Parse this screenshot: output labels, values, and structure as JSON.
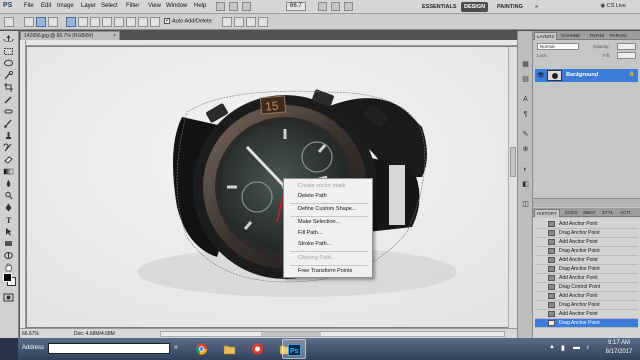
{
  "app": {
    "logo": "PS",
    "menus": [
      "File",
      "Edit",
      "Image",
      "Layer",
      "Select",
      "Filter",
      "View",
      "Window",
      "Help"
    ],
    "zoom_select": "66.7",
    "workspaces": [
      "ESSENTIALS",
      "DESIGN",
      "PAINTING"
    ],
    "active_workspace": "DESIGN",
    "more": "»",
    "cs_live": "CS Live"
  },
  "options_bar": {
    "auto_add_delete": "Auto Add/Delete",
    "auto_add_delete_checked": true
  },
  "document": {
    "tab_title": "142656.jpg @ 66.7% (RGB/8#)",
    "close": "×",
    "zoom": "66.67%",
    "info": "Doc: 4.68M/4.68M",
    "image_subject": "wristwatch",
    "dial_numeral": "15"
  },
  "context_menu": {
    "items": [
      {
        "label": "Create vector mask",
        "enabled": false
      },
      {
        "label": "Delete Path",
        "enabled": true
      },
      {
        "label": "Define Custom Shape...",
        "enabled": true
      },
      {
        "label": "Make Selection...",
        "enabled": true
      },
      {
        "label": "Fill Path...",
        "enabled": true
      },
      {
        "label": "Stroke Path...",
        "enabled": true
      },
      {
        "label": "Clipping Path...",
        "enabled": false
      },
      {
        "label": "Free Transform Points",
        "enabled": true
      }
    ]
  },
  "layers_panel": {
    "tabs": [
      "LAYERS",
      "CHANNE",
      "PATHS",
      "PARAGI"
    ],
    "active_tab": "LAYERS",
    "blend_mode": "Normal",
    "opacity_label": "Opacity:",
    "lock_label": "Lock:",
    "fill_label": "Fill:",
    "layer_name": "Background"
  },
  "history_panel": {
    "tabs": [
      "HISTORY",
      "COLO",
      "SWAT",
      "STYL",
      "ACTI"
    ],
    "active_tab": "HISTORY",
    "items": [
      "Add Anchor Point",
      "Drag Anchor Point",
      "Add Anchor Point",
      "Drag Anchor Point",
      "Add Anchor Point",
      "Drag Anchor Point",
      "Add Anchor Point",
      "Drag Control Point",
      "Add Anchor Point",
      "Drag Anchor Point",
      "Add Anchor Point",
      "Drag Anchor Point"
    ],
    "selected_index": 11
  },
  "taskbar": {
    "address_label": "Address",
    "address_arrow": "»",
    "tray_chevron": "▲",
    "time": "9:17 AM",
    "date": "8/17/2017"
  },
  "colors": {
    "ui_bg": "#535353",
    "selection_blue": "#3d7bd8",
    "taskbar_top": "#5b6c88",
    "taskbar_bottom": "#31405a"
  }
}
